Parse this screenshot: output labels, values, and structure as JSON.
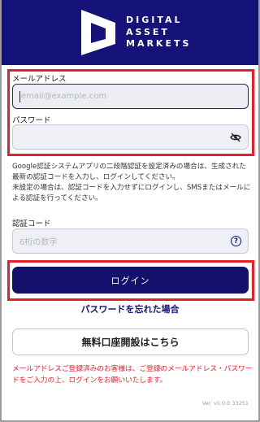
{
  "brand": {
    "line1": "DIGITAL",
    "line2": "ASSET",
    "line3": "MARKETS",
    "bg_color": "#15127a"
  },
  "email": {
    "label": "メールアドレス",
    "placeholder": "email@example.com"
  },
  "password": {
    "label": "パスワード",
    "placeholder": "",
    "toggle_icon": "eye-slash-icon"
  },
  "note": {
    "line1": "Google認証システムアプリの二段階認証を設定済みの場合は、生成された最新の認証コードを入力し、ログインしてください。",
    "line2": "未設定の場合は、認証コードを入力せずにログインし、SMSまたはメールによる認証を行ってください。"
  },
  "auth_code": {
    "label": "認証コード",
    "placeholder": "6桁の数字",
    "help_icon": "question-circle-icon",
    "help_glyph": "?"
  },
  "actions": {
    "login_label": "ログイン",
    "forgot_label": "パスワードを忘れた場合",
    "open_account_label": "無料口座開設はこちら",
    "primary_color": "#14106c"
  },
  "warning": {
    "text": "メールアドレスご登録済みのお客様は、ご登録のメールアドレス・パスワードをご入力の上、ログインをお願いいたします。",
    "color": "#e5202a"
  },
  "version": "Ver. v0.0.0 33251"
}
